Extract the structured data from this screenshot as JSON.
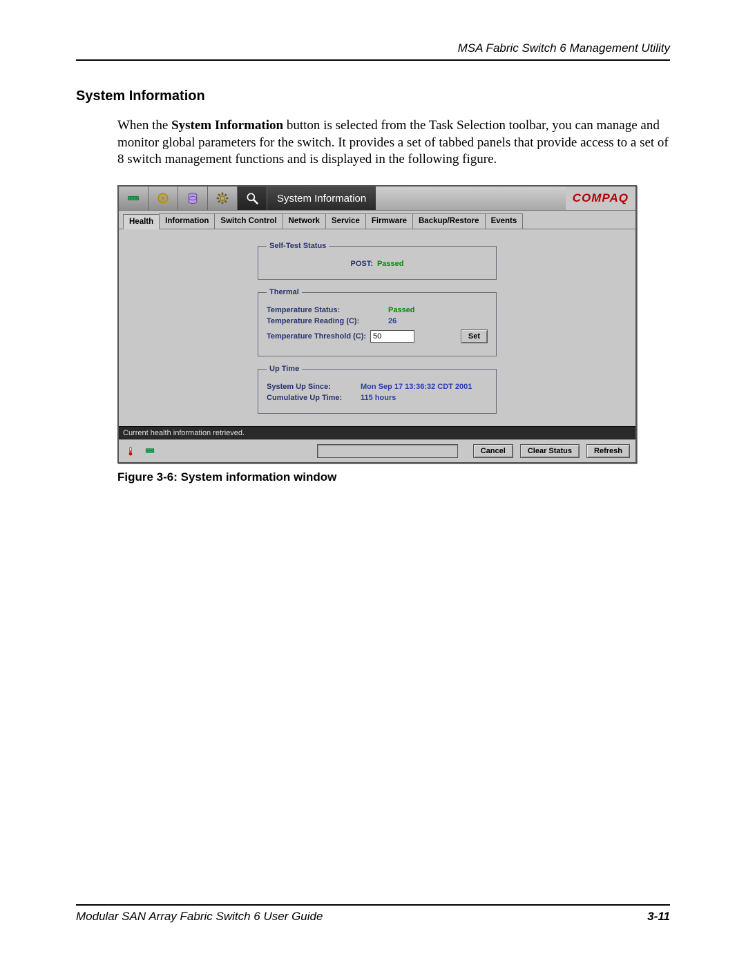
{
  "page": {
    "running_header": "MSA Fabric Switch 6 Management Utility",
    "section_title": "System Information",
    "body_text_pre": "When the ",
    "body_text_strong": "System Information",
    "body_text_post": " button is selected from the Task Selection toolbar, you can manage and monitor global parameters for the switch. It provides a set of tabbed panels that provide access to a set of 8 switch management functions and is displayed in the following figure.",
    "figure_caption": "Figure 3-6:  System information window",
    "footer_left": "Modular SAN Array Fabric Switch 6 User Guide",
    "footer_right": "3-11"
  },
  "app": {
    "brand": "COMPAQ",
    "title": "System Information",
    "tabs": [
      "Health",
      "Information",
      "Switch Control",
      "Network",
      "Service",
      "Firmware",
      "Backup/Restore",
      "Events"
    ],
    "active_tab_index": 0,
    "selftest": {
      "legend": "Self-Test Status",
      "label": "POST:",
      "value": "Passed"
    },
    "thermal": {
      "legend": "Thermal",
      "status_label": "Temperature Status:",
      "status_value": "Passed",
      "reading_label": "Temperature Reading (C):",
      "reading_value": "26",
      "threshold_label": "Temperature Threshold (C):",
      "threshold_value": "50",
      "set_button": "Set"
    },
    "uptime": {
      "legend": "Up Time",
      "since_label": "System Up Since:",
      "since_value": "Mon Sep 17 13:36:32 CDT 2001",
      "cum_label": "Cumulative Up Time:",
      "cum_value": "115 hours"
    },
    "status_message": "Current health information retrieved.",
    "buttons": {
      "cancel": "Cancel",
      "clear_status": "Clear Status",
      "refresh": "Refresh"
    }
  }
}
